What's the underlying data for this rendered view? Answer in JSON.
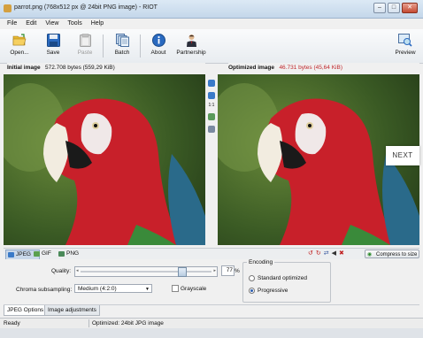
{
  "window": {
    "title": "parrot.png (768x512 px @ 24bit PNG image) - RIOT",
    "min": "–",
    "max": "□",
    "close": "✕"
  },
  "menu": [
    "File",
    "Edit",
    "View",
    "Tools",
    "Help"
  ],
  "toolbar": {
    "open": "Open...",
    "save": "Save",
    "paste": "Paste",
    "batch": "Batch",
    "about": "About",
    "partnership": "Partnership",
    "preview": "Preview"
  },
  "initial": {
    "label": "Initial image",
    "size": "572.708 bytes (559,29 KiB)"
  },
  "optimized": {
    "label": "Optimized image",
    "size": "46.731 bytes (45,64 KiB)",
    "size_color": "#c0282c"
  },
  "zoom": {
    "one_to_one": "1:1"
  },
  "overlay": {
    "next": "NEXT"
  },
  "formats": [
    "JPEG",
    "GIF",
    "PNG"
  ],
  "compress_label": "Compress to size",
  "options": {
    "quality_label": "Quality:",
    "quality_value": "77",
    "quality_unit": "%",
    "chroma_label": "Chroma subsampling:",
    "chroma_value": "Medium (4:2:0)",
    "grayscale_label": "Grayscale",
    "encoding_label": "Encoding",
    "encoding_options": [
      "Standard optimized",
      "Progressive"
    ],
    "encoding_selected": "Progressive"
  },
  "tabs": [
    "JPEG Options",
    "Image adjustments"
  ],
  "status": {
    "left": "Ready",
    "right": "Optimized: 24bit JPG image"
  },
  "colors": {
    "accent": "#2a5db0",
    "parrot_red": "#c8202a",
    "foliage": "#3a5a2a"
  }
}
